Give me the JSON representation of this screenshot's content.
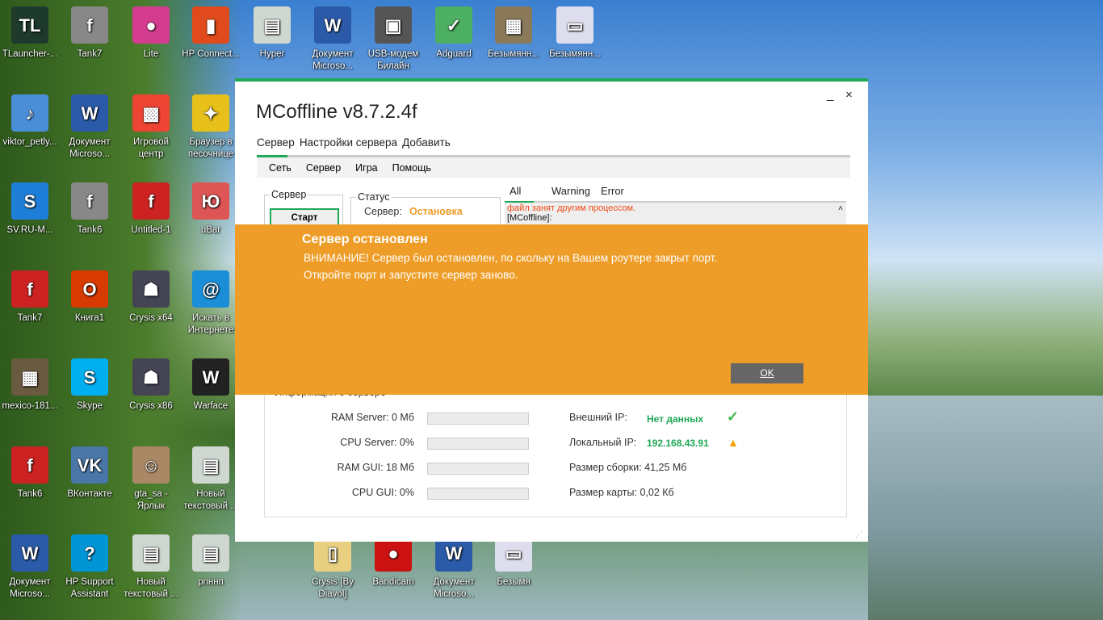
{
  "desktop": {
    "icons": [
      {
        "label": "TLauncher-...",
        "glyph": "TL",
        "color": "#1d3a2c",
        "col": 0,
        "row": 0
      },
      {
        "label": "Tank7",
        "glyph": "f",
        "color": "#888",
        "col": 1,
        "row": 0
      },
      {
        "label": "Lite",
        "glyph": "●",
        "color": "#d43c8f",
        "col": 2,
        "row": 0
      },
      {
        "label": "HP Connect...",
        "glyph": "▮",
        "color": "#e04a1c",
        "col": 3,
        "row": 0
      },
      {
        "label": "Hyper",
        "glyph": "▤",
        "color": "#cfd8d0",
        "col": 4,
        "row": 0
      },
      {
        "label": "Документ Microso...",
        "glyph": "W",
        "color": "#2b5ba8",
        "col": 5,
        "row": 0
      },
      {
        "label": "USB-модем Билайн",
        "glyph": "▣",
        "color": "#555",
        "col": 6,
        "row": 0
      },
      {
        "label": "Adguard",
        "glyph": "✓",
        "color": "#4caf62",
        "col": 7,
        "row": 0
      },
      {
        "label": "Безымянн...",
        "glyph": "▦",
        "color": "#8a7a5a",
        "col": 8,
        "row": 0
      },
      {
        "label": "Безымянн...",
        "glyph": "▭",
        "color": "#dde",
        "col": 9,
        "row": 0
      },
      {
        "label": "viktor_petly...",
        "glyph": "♪",
        "color": "#4a8ed8",
        "col": 0,
        "row": 1
      },
      {
        "label": "SV.RU-M...",
        "glyph": "S",
        "color": "#1f7fd8",
        "col": 0,
        "row": 2
      },
      {
        "label": "Tank7",
        "glyph": "f",
        "color": "#c22",
        "col": 0,
        "row": 3
      },
      {
        "label": "mexico-181...",
        "glyph": "▦",
        "color": "#6a5a40",
        "col": 0,
        "row": 4
      },
      {
        "label": "Tank6",
        "glyph": "f",
        "color": "#c22",
        "col": 0,
        "row": 5
      },
      {
        "label": "Документ Microso...",
        "glyph": "W",
        "color": "#2b5ba8",
        "col": 0,
        "row": 6
      },
      {
        "label": "Документ Microso...",
        "glyph": "W",
        "color": "#2b5ba8",
        "col": 1,
        "row": 1
      },
      {
        "label": "Tank6",
        "glyph": "f",
        "color": "#888",
        "col": 1,
        "row": 2
      },
      {
        "label": "Книга1",
        "glyph": "O",
        "color": "#d83b01",
        "col": 1,
        "row": 3
      },
      {
        "label": "Skype",
        "glyph": "S",
        "color": "#00aff0",
        "col": 1,
        "row": 4
      },
      {
        "label": "ВКонтакте",
        "glyph": "VK",
        "color": "#4a76a8",
        "col": 1,
        "row": 5
      },
      {
        "label": "HP Support Assistant",
        "glyph": "?",
        "color": "#0096d6",
        "col": 1,
        "row": 6
      },
      {
        "label": "Игровой центр",
        "glyph": "▩",
        "color": "#e43",
        "col": 2,
        "row": 1
      },
      {
        "label": "Untitled-1",
        "glyph": "f",
        "color": "#c22",
        "col": 2,
        "row": 2
      },
      {
        "label": "Crysis x64",
        "glyph": "☗",
        "color": "#445",
        "col": 2,
        "row": 3
      },
      {
        "label": "Crysis x86",
        "glyph": "☗",
        "color": "#445",
        "col": 2,
        "row": 4
      },
      {
        "label": "gta_sa - Ярлык",
        "glyph": "☺",
        "color": "#a86",
        "col": 2,
        "row": 5
      },
      {
        "label": "Новый текстовый ...",
        "glyph": "▤",
        "color": "#cfd8d0",
        "col": 2,
        "row": 6
      },
      {
        "label": "Браузер в песочнице",
        "glyph": "✦",
        "color": "#e8c01a",
        "col": 3,
        "row": 1
      },
      {
        "label": "uBar",
        "glyph": "Ю",
        "color": "#d55",
        "col": 3,
        "row": 2
      },
      {
        "label": "Искать в Интернете",
        "glyph": "@",
        "color": "#1a8fd8",
        "col": 3,
        "row": 3
      },
      {
        "label": "Warface",
        "glyph": "W",
        "color": "#222",
        "col": 3,
        "row": 4
      },
      {
        "label": "Новый текстовый ...",
        "glyph": "▤",
        "color": "#cfd8d0",
        "col": 3,
        "row": 5
      },
      {
        "label": "рпннп",
        "glyph": "▤",
        "color": "#cfd8d0",
        "col": 3,
        "row": 6
      },
      {
        "label": "Crysis [By Diavol]",
        "glyph": "▯",
        "color": "#e8d080",
        "col": 5,
        "row": 6
      },
      {
        "label": "Bandicam",
        "glyph": "●",
        "color": "#c11",
        "col": 6,
        "row": 6
      },
      {
        "label": "Документ Microso...",
        "glyph": "W",
        "color": "#2b5ba8",
        "col": 7,
        "row": 6
      },
      {
        "label": "Безымя",
        "glyph": "▭",
        "color": "#dde",
        "col": 8,
        "row": 6
      }
    ]
  },
  "window": {
    "title": "MCoffline v8.7.2.4f",
    "minimize": "_",
    "close": "×",
    "tabs": [
      "Сервер",
      "Настройки сервера",
      "Добавить"
    ],
    "menu": [
      "Сеть",
      "Сервер",
      "Игра",
      "Помощь"
    ],
    "server_group": "Сервер",
    "start_button": "Старт",
    "status_group": "Статус",
    "status_label": "Сервер:",
    "status_value": "Остановка",
    "log_tabs": [
      "All",
      "Warning",
      "Error"
    ],
    "log_lines": [
      "файл занят другим процессом.",
      "[MCoffline]:"
    ],
    "info_group": "Информация о сервере",
    "stats": [
      {
        "label": "RAM Server: 0 Мб",
        "fill": 0
      },
      {
        "label": "CPU Server: 0%",
        "fill": 0
      },
      {
        "label": "RAM GUI: 18 Мб",
        "fill": 0
      },
      {
        "label": "CPU GUI: 0%",
        "fill": 0
      }
    ],
    "external_ip_label": "Внешний IP:",
    "external_ip_value": "Нет данных",
    "external_ip_icon": "check-icon",
    "local_ip_label": "Локальный IP:",
    "local_ip_value": "192.168.43.91",
    "local_ip_icon": "warning-icon",
    "build_size": "Размер сборки: 41,25 Мб",
    "map_size": "Размер карты: 0,02 Кб",
    "accent": "#1fa855",
    "status_color": "#ee9d28"
  },
  "dialog": {
    "title": "Сервер остановлен",
    "line1": "ВНИМАНИЕ! Сервер был остановлен, по скольку на Вашем роутере закрыт порт.",
    "line2": "Откройте порт и запустите сервер заново.",
    "ok": "OK",
    "color": "#ee9d28"
  }
}
